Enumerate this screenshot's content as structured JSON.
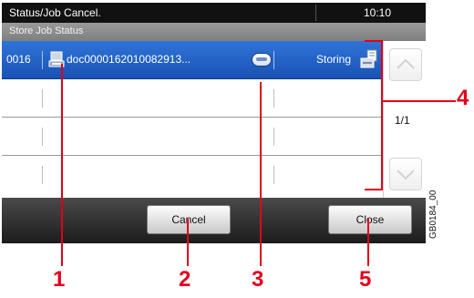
{
  "titlebar": {
    "title": "Status/Job Cancel.",
    "clock": "10:10"
  },
  "subtitle": "Store Job Status",
  "jobs": [
    {
      "number": "0016",
      "document": "doc0000162010082913...",
      "status": "Storing",
      "selected": true
    },
    {
      "number": "",
      "document": "",
      "status": "",
      "selected": false
    },
    {
      "number": "",
      "document": "",
      "status": "",
      "selected": false
    },
    {
      "number": "",
      "document": "",
      "status": "",
      "selected": false
    }
  ],
  "scroll": {
    "page": "1/1"
  },
  "buttons": {
    "cancel": "Cancel",
    "close": "Close"
  },
  "callouts": {
    "c1": "1",
    "c2": "2",
    "c3": "3",
    "c4": "4",
    "c5": "5"
  },
  "figure_code": "GB0184_00",
  "colors": {
    "selected_row": "#1f5fc8",
    "callout": "#e2001a",
    "titlebar": "#111111"
  }
}
